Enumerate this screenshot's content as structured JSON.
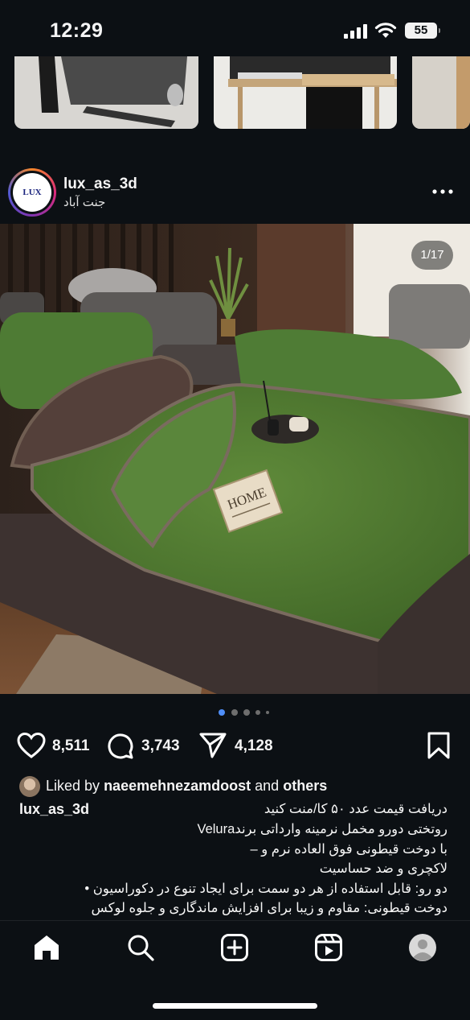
{
  "status_bar": {
    "time": "12:29",
    "battery": "55"
  },
  "post": {
    "username": "lux_as_3d",
    "location": "جنت آباد",
    "avatar_text": "LUX AS3D",
    "image_counter": "1/17",
    "image_label": "HOME",
    "carousel_dots": 5,
    "active_dot": 0
  },
  "actions": {
    "likes": "8,511",
    "comments": "3,743",
    "shares": "4,128"
  },
  "liked_by": {
    "prefix": "Liked by",
    "user": "naeemehnezamdoost",
    "middle": "and",
    "others": "others"
  },
  "caption": {
    "username": "lux_as_3d",
    "lines": [
      "دریافت قیمت عدد ۵۰ کا/منت کنید",
      "روتختی دورو مخمل نرمینه وارداتی برندVelura",
      "با دوخت قیطونی فوق العاده نرم و –",
      "لاکچری و ضد حساسیت",
      "دو رو: قابل استفاده از هر دو سمت برای ایجاد تنوع در دکوراسیون •",
      "دوخت قیطونی: مقاوم و زیبا برای افزایش ماندگاری و جلوه لوکس"
    ]
  },
  "colors": {
    "background": "#0c1014",
    "text": "#f5f5f5",
    "active_dot": "#4f8ef7",
    "inactive_dot": "#6e6e6e"
  },
  "icons": [
    "heart-icon",
    "comment-icon",
    "share-icon",
    "bookmark-icon",
    "home-icon",
    "search-icon",
    "create-icon",
    "reels-icon",
    "profile-icon"
  ]
}
